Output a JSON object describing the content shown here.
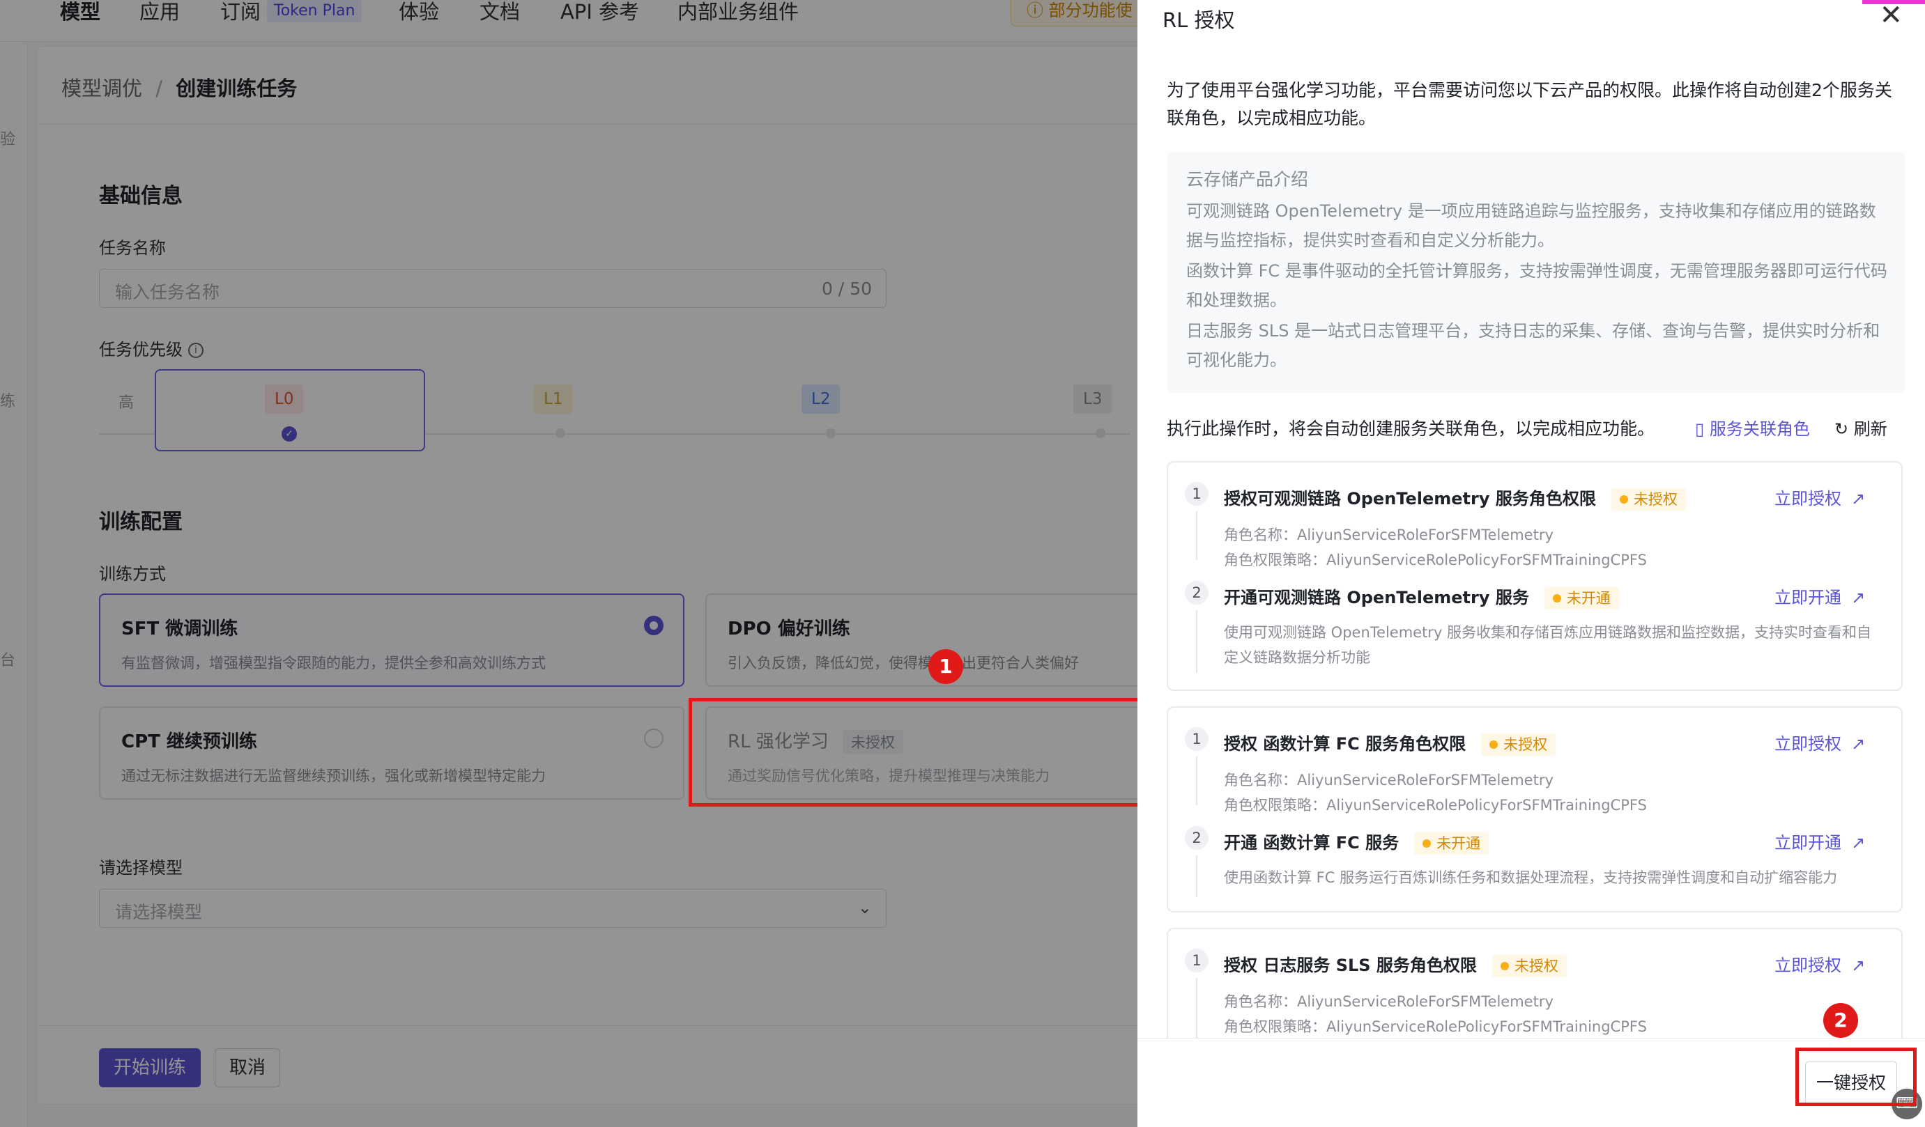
{
  "nav": {
    "items": [
      "模型",
      "应用",
      "订阅",
      "体验",
      "文档",
      "API 参考",
      "内部业务组件"
    ],
    "token_badge": "Token Plan",
    "warning": "部分功能使"
  },
  "rail": [
    "验",
    "练",
    "台"
  ],
  "breadcrumb": {
    "parent": "模型调优",
    "separator": "/",
    "current": "创建训练任务"
  },
  "basic": {
    "title": "基础信息",
    "task_name_label": "任务名称",
    "task_name_placeholder": "输入任务名称",
    "task_name_count": "0 / 50",
    "priority_label": "任务优先级",
    "priority_high": "高",
    "priority_levels": [
      "L0",
      "L1",
      "L2",
      "L3"
    ]
  },
  "training": {
    "title": "训练配置",
    "method_label": "训练方式",
    "methods": [
      {
        "name": "SFT 微调训练",
        "desc": "有监督微调，增强模型指令跟随的能力，提供全参和高效训练方式",
        "selected": true
      },
      {
        "name": "DPO 偏好训练",
        "desc": "引入负反馈，降低幻觉，使得模型输出更符合人类偏好",
        "selected": false
      },
      {
        "name": "CPT 继续预训练",
        "desc": "通过无标注数据进行无监督继续预训练，强化或新增模型特定能力",
        "selected": false
      },
      {
        "name": "RL 强化学习",
        "tag": "未授权",
        "desc": "通过奖励信号优化策略，提升模型推理与决策能力",
        "selected": false
      }
    ],
    "model_label": "请选择模型",
    "model_placeholder": "请选择模型"
  },
  "footer": {
    "start": "开始训练",
    "cancel": "取消"
  },
  "annotations": {
    "badge1": "1",
    "badge2": "2"
  },
  "drawer": {
    "title": "RL 授权",
    "close": "✕",
    "intro": "为了使用平台强化学习功能，平台需要访问您以下云产品的权限。此操作将自动创建2个服务关联角色，以完成相应功能。",
    "panel_title": "云存储产品介绍",
    "panel_paras": [
      "可观测链路 OpenTelemetry 是一项应用链路追踪与监控服务，支持收集和存储应用的链路数据与监控指标，提供实时查看和自定义分析能力。",
      "函数计算 FC 是事件驱动的全托管计算服务，支持按需弹性调度，无需管理服务器即可运行代码和处理数据。",
      "日志服务 SLS 是一站式日志管理平台，支持日志的采集、存储、查询与告警，提供实时分析和可视化能力。"
    ],
    "action_text": "执行此操作时，将会自动创建服务关联角色，以完成相应功能。",
    "role_link": "服务关联角色",
    "refresh": "刷新",
    "groups": [
      {
        "steps": [
          {
            "num": "1",
            "title": "授权可观测链路 OpenTelemetry 服务角色权限",
            "status": "未授权",
            "action": "立即授权",
            "role_name": "角色名称：AliyunServiceRoleForSFMTelemetry",
            "role_policy": "角色权限策略：AliyunServiceRolePolicyForSFMTrainingCPFS"
          },
          {
            "num": "2",
            "title": "开通可观测链路 OpenTelemetry 服务",
            "status": "未开通",
            "action": "立即开通",
            "desc": "使用可观测链路 OpenTelemetry 服务收集和存储百炼应用链路数据和监控数据，支持实时查看和自定义链路数据分析功能"
          }
        ]
      },
      {
        "steps": [
          {
            "num": "1",
            "title": "授权 函数计算 FC 服务角色权限",
            "status": "未授权",
            "action": "立即授权",
            "role_name": "角色名称：AliyunServiceRoleForSFMTelemetry",
            "role_policy": "角色权限策略：AliyunServiceRolePolicyForSFMTrainingCPFS"
          },
          {
            "num": "2",
            "title": "开通 函数计算 FC 服务",
            "status": "未开通",
            "action": "立即开通",
            "desc": "使用函数计算 FC 服务运行百炼训练任务和数据处理流程，支持按需弹性调度和自动扩缩容能力"
          }
        ]
      },
      {
        "steps": [
          {
            "num": "1",
            "title": "授权 日志服务 SLS 服务角色权限",
            "status": "未授权",
            "action": "立即授权",
            "role_name": "角色名称：AliyunServiceRoleForSFMTelemetry",
            "role_policy": "角色权限策略：AliyunServiceRolePolicyForSFMTrainingCPFS"
          }
        ]
      }
    ],
    "one_click": "一键授权"
  },
  "colors": {
    "primary": "#5b54d6",
    "annotation_red": "#e01919",
    "status_warn": "#d48806"
  },
  "icons": {
    "close": "close-icon",
    "refresh": "refresh-icon",
    "document": "document-icon",
    "external": "external-link-icon",
    "chevron": "chevron-down-icon",
    "info": "info-icon"
  }
}
